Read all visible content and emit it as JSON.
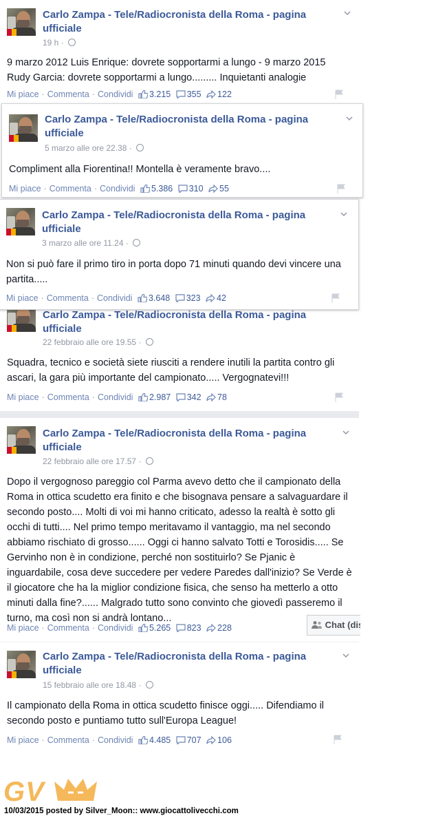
{
  "ui": {
    "author": "Carlo Zampa - Tele/Radiocronista della Roma - pagina ufficiale",
    "like": "Mi piace",
    "comment": "Commenta",
    "share": "Condividi"
  },
  "posts": [
    {
      "time": "19 h",
      "text": "9 marzo 2012 Luis Enrique: dovrete sopportarmi a lungo - 9 marzo 2015 Rudy Garcia: dovrete sopportarmi a lungo......... Inquietanti analogie",
      "likes": "3.215",
      "comments": "355",
      "shares": "122"
    },
    {
      "time": "5 marzo alle ore 22.38",
      "text": "Compliment alla Fiorentina!! Montella è veramente bravo....",
      "likes": "5.386",
      "comments": "310",
      "shares": "55"
    },
    {
      "time": "3 marzo alle ore 11.24",
      "text": "Non si può fare il primo tiro in porta dopo 71 minuti quando devi vincere una partita.....",
      "likes": "3.648",
      "comments": "323",
      "shares": "42"
    },
    {
      "time": "22 febbraio alle ore 19.55",
      "text": "Squadra, tecnico e società siete riusciti a rendere inutili la partita contro gli ascari, la gara più importante del campionato..... Vergognatevi!!!",
      "likes": "2.987",
      "comments": "342",
      "shares": "78"
    },
    {
      "time": "22 febbraio alle ore 17.57",
      "text": "Dopo il vergognoso pareggio col Parma avevo detto che il campionato della Roma in ottica scudetto era finito e che bisognava pensare a salvaguardare il secondo posto.... Molti di voi mi hanno criticato, adesso la realtà è sotto gli occhi di tutti.... Nel primo tempo meritavamo il vantaggio, ma nel secondo abbiamo rischiato di grosso...... Oggi ci hanno salvato Totti e Torosidis..... Se Gervinho non è in condizione, perché non sostituirlo? Se Pjanic è inguardabile, cosa deve succedere per vedere Paredes dall'inizio? Se Verde è il giocatore che ha la miglior condizione fisica, che senso ha metterlo a otto minuti dalla fine?...... Malgrado tutto sono convinto che giovedì passeremo il turno, ma così non si andrà lontano...",
      "likes": "5.265",
      "comments": "823",
      "shares": "228"
    },
    {
      "time": "15 febbraio alle ore 18.48",
      "text": "Il campionato della Roma in ottica scudetto finisce oggi..... Difendiamo il secondo posto e puntiamo tutto sull'Europa League!",
      "likes": "4.485",
      "comments": "707",
      "shares": "106"
    }
  ],
  "chat": {
    "label": "Chat (dis"
  },
  "watermark": {
    "logo": "GV",
    "caption": "10/03/2015 posted by Silver_Moon:: www.giocattolivecchi.com"
  },
  "colors": {
    "link": "#3b5998",
    "action": "#6d84b4",
    "meta": "#9197a3",
    "logo": "#f5b85a"
  }
}
